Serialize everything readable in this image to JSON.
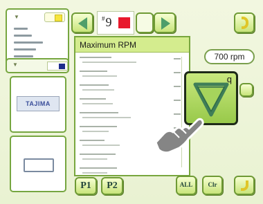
{
  "toolbar": {
    "needle_number_hash": "#",
    "needle_number": "9",
    "needle_color": "#e8192c"
  },
  "popup": {
    "title": "Maximum RPM"
  },
  "speed": {
    "rpm_value": "700 rpm",
    "down_label": "q"
  },
  "bottom": {
    "p1_label": "P1",
    "p2_label": "P2",
    "all_label": "ALL",
    "clear_label": "Clr"
  },
  "preview": {
    "logo_text": "TAJIMA"
  },
  "colors": {
    "accent_green": "#76a640",
    "thread_color_swatch": "#1e2c8c",
    "yellow_chip": "#f6e53c"
  }
}
